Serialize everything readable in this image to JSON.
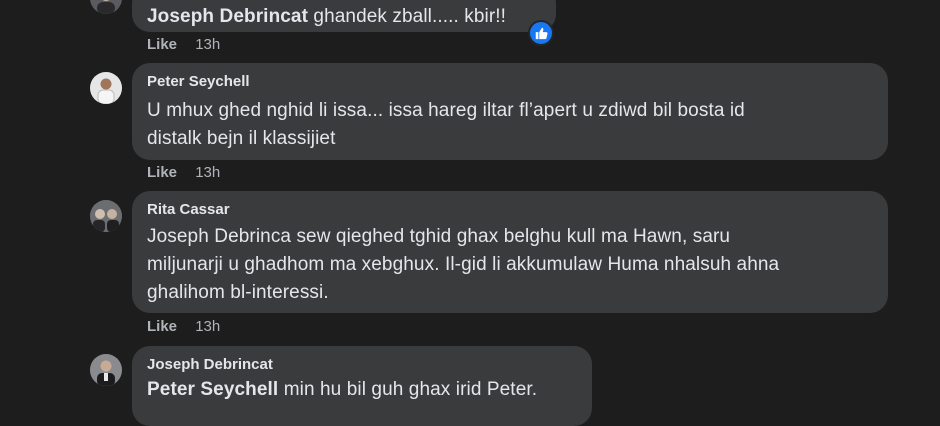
{
  "comments": [
    {
      "author": "Joseph Debrincat",
      "text": "ghandek zball..... kbir!!",
      "like_label": "Like",
      "time": "13h",
      "reaction_icon": "like-thumb-icon"
    },
    {
      "author": "Peter Seychell",
      "text_line1": "U mhux ghed nghid li issa... issa hareg iltar fl’apert u zdiwd bil bosta id",
      "text_line2": "distalk bejn il klassijiet",
      "like_label": "Like",
      "time": "13h"
    },
    {
      "author": "Rita Cassar",
      "text_line1": "Joseph Debrinca sew qieghed tghid ghax belghu kull ma Hawn, saru",
      "text_line2": "miljunarji u ghadhom ma xebghux. Il-gid li akkumulaw Huma nhalsuh ahna",
      "text_line3": "ghalihom bl-interessi.",
      "like_label": "Like",
      "time": "13h"
    },
    {
      "author": "Joseph Debrincat",
      "mention": "Peter Seychell",
      "text": "min hu bil guh ghax irid Peter."
    }
  ],
  "colors": {
    "background": "#1d1d1e",
    "bubble": "#3a3b3c",
    "text": "#e4e6eb",
    "meta": "#b0b3b8",
    "reaction": "#1877f2"
  }
}
